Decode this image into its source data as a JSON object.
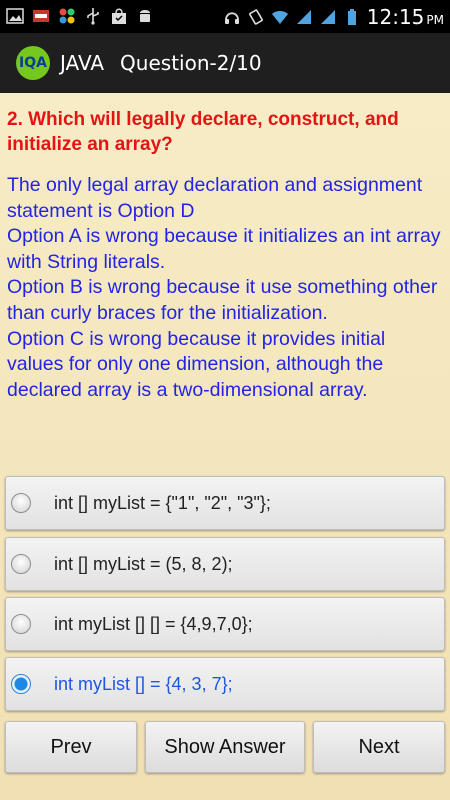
{
  "status_bar": {
    "time": "12:15",
    "ampm": "PM",
    "left_icons": [
      "image-icon",
      "ndtv-icon",
      "app-grid-icon",
      "usb-icon",
      "shopping-bag-icon",
      "android-icon"
    ],
    "right_icons": [
      "headphones-icon",
      "vibrate-icon",
      "wifi-icon",
      "signal-icon",
      "signal-icon",
      "battery-icon"
    ]
  },
  "action_bar": {
    "logo_text": "IQA",
    "app_name": "JAVA",
    "question_counter": "Question-2/10"
  },
  "question": {
    "text": "2. Which will legally declare, construct, and initialize an array?"
  },
  "explanation": {
    "text": "The only legal array declaration and assignment statement is Option D\nOption A is wrong because it initializes an int array with String literals.\nOption B is wrong because it use something other than curly braces for the initialization.\nOption C is wrong because it provides initial values for only one dimension, although the declared array is a two-dimensional array."
  },
  "options": [
    {
      "label": "int [] myList = {\"1\", \"2\", \"3\"};",
      "selected": false
    },
    {
      "label": "int [] myList = (5, 8, 2);",
      "selected": false
    },
    {
      "label": "int myList [] [] = {4,9,7,0};",
      "selected": false
    },
    {
      "label": "int myList [] = {4, 3, 7};",
      "selected": true
    }
  ],
  "buttons": {
    "prev": "Prev",
    "show_answer": "Show Answer",
    "next": "Next"
  },
  "colors": {
    "question": "#e31414",
    "explanation": "#2323e6",
    "selected_option": "#1e56e0",
    "background": "#f3e4b8",
    "action_bar": "#1f1f1f"
  }
}
